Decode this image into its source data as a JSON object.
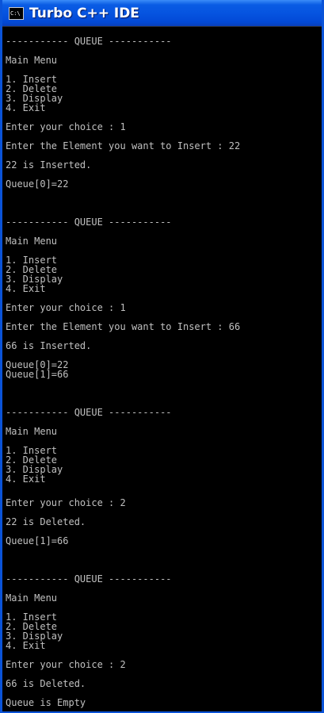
{
  "window": {
    "title": "Turbo C++ IDE",
    "icon": "cmd-console-icon",
    "icon_text": "C:\\"
  },
  "console": {
    "lines": [
      "----------- QUEUE -----------",
      "Main Menu",
      "1. Insert",
      "2. Delete",
      "3. Display",
      "4. Exit",
      "Enter your choice : 1",
      "Enter the Element you want to Insert : 22",
      "22 is Inserted.",
      "Queue[0]=22",
      "----------- QUEUE -----------",
      "Main Menu",
      "1. Insert",
      "2. Delete",
      "3. Display",
      "4. Exit",
      "Enter your choice : 1",
      "Enter the Element you want to Insert : 66",
      "66 is Inserted.",
      "Queue[0]=22",
      "Queue[1]=66",
      "----------- QUEUE -----------",
      "Main Menu",
      "1. Insert",
      "2. Delete",
      "3. Display",
      "4. Exit",
      "Enter your choice : 2",
      "22 is Deleted.",
      "Queue[1]=66",
      "----------- QUEUE -----------",
      "Main Menu",
      "1. Insert",
      "2. Delete",
      "3. Display",
      "4. Exit",
      "Enter your choice : 2",
      "66 is Deleted.",
      "Queue is Empty"
    ]
  },
  "colors": {
    "title_bar": "#0654e0",
    "console_bg": "#000000",
    "console_text": "#c0c0c0"
  }
}
